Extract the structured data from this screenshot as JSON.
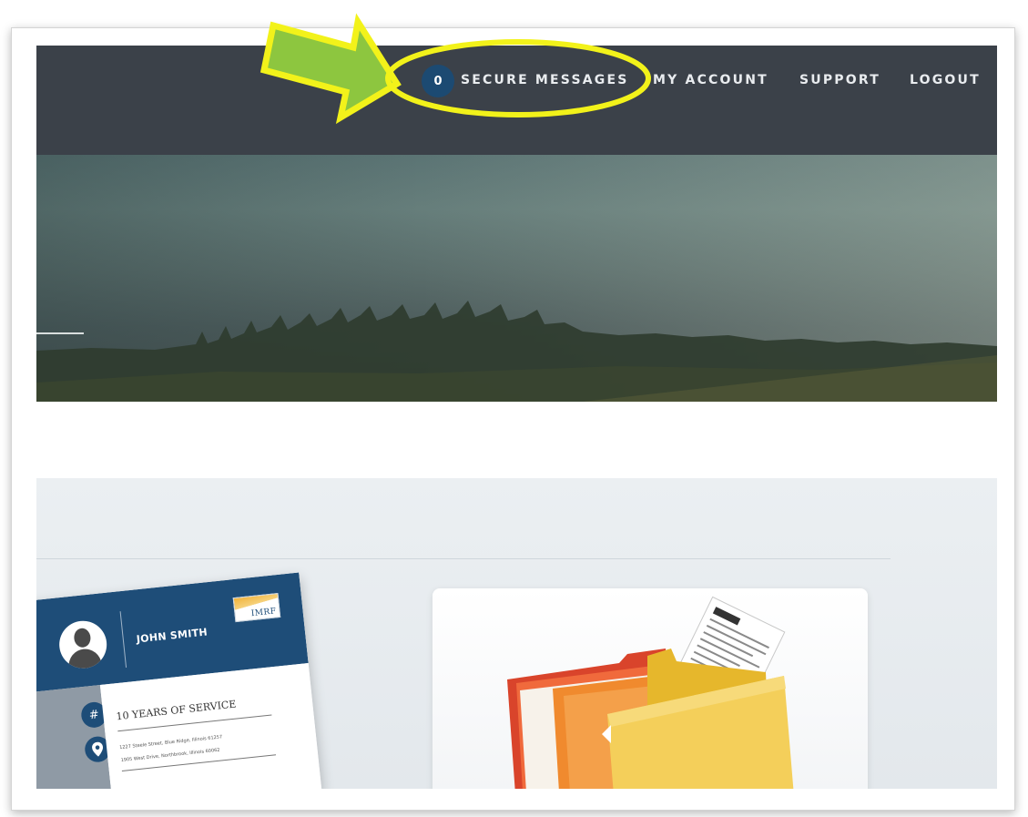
{
  "nav": {
    "message_count": "0",
    "items": [
      {
        "label": "SECURE MESSAGES"
      },
      {
        "label": "MY ACCOUNT"
      },
      {
        "label": "SUPPORT"
      },
      {
        "label": "LOGOUT"
      }
    ]
  },
  "card": {
    "name": "JOHN SMITH",
    "logo_text": "IMRF",
    "years": "10 YEARS OF SERVICE",
    "address_1": "1227 Steele Street, Blue Ridge, Illinois 61257",
    "address_2": "1905 West Drive, Northbrook, Illinois 60062"
  },
  "colors": {
    "navbar": "#3b4149",
    "badge": "#1c4a72",
    "card_blue": "#1e4d78",
    "annotation_yellow": "#f2f21a",
    "annotation_green": "#8dc63f"
  },
  "icons": {
    "calendar": "calendar-hash-icon",
    "location": "location-pin-icon",
    "user": "user-silhouette-icon",
    "folder": "folder-documents-icon"
  }
}
